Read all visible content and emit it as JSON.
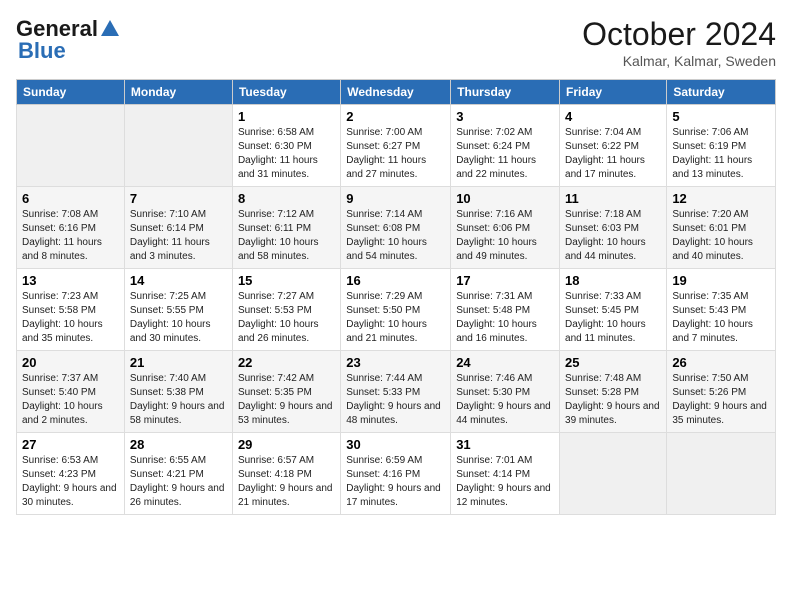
{
  "logo": {
    "general": "General",
    "blue": "Blue"
  },
  "header": {
    "month": "October 2024",
    "location": "Kalmar, Kalmar, Sweden"
  },
  "days_of_week": [
    "Sunday",
    "Monday",
    "Tuesday",
    "Wednesday",
    "Thursday",
    "Friday",
    "Saturday"
  ],
  "weeks": [
    [
      {
        "day": "",
        "empty": true
      },
      {
        "day": "",
        "empty": true
      },
      {
        "day": "1",
        "sunrise": "6:58 AM",
        "sunset": "6:30 PM",
        "daylight": "11 hours and 31 minutes."
      },
      {
        "day": "2",
        "sunrise": "7:00 AM",
        "sunset": "6:27 PM",
        "daylight": "11 hours and 27 minutes."
      },
      {
        "day": "3",
        "sunrise": "7:02 AM",
        "sunset": "6:24 PM",
        "daylight": "11 hours and 22 minutes."
      },
      {
        "day": "4",
        "sunrise": "7:04 AM",
        "sunset": "6:22 PM",
        "daylight": "11 hours and 17 minutes."
      },
      {
        "day": "5",
        "sunrise": "7:06 AM",
        "sunset": "6:19 PM",
        "daylight": "11 hours and 13 minutes."
      }
    ],
    [
      {
        "day": "6",
        "sunrise": "7:08 AM",
        "sunset": "6:16 PM",
        "daylight": "11 hours and 8 minutes."
      },
      {
        "day": "7",
        "sunrise": "7:10 AM",
        "sunset": "6:14 PM",
        "daylight": "11 hours and 3 minutes."
      },
      {
        "day": "8",
        "sunrise": "7:12 AM",
        "sunset": "6:11 PM",
        "daylight": "10 hours and 58 minutes."
      },
      {
        "day": "9",
        "sunrise": "7:14 AM",
        "sunset": "6:08 PM",
        "daylight": "10 hours and 54 minutes."
      },
      {
        "day": "10",
        "sunrise": "7:16 AM",
        "sunset": "6:06 PM",
        "daylight": "10 hours and 49 minutes."
      },
      {
        "day": "11",
        "sunrise": "7:18 AM",
        "sunset": "6:03 PM",
        "daylight": "10 hours and 44 minutes."
      },
      {
        "day": "12",
        "sunrise": "7:20 AM",
        "sunset": "6:01 PM",
        "daylight": "10 hours and 40 minutes."
      }
    ],
    [
      {
        "day": "13",
        "sunrise": "7:23 AM",
        "sunset": "5:58 PM",
        "daylight": "10 hours and 35 minutes."
      },
      {
        "day": "14",
        "sunrise": "7:25 AM",
        "sunset": "5:55 PM",
        "daylight": "10 hours and 30 minutes."
      },
      {
        "day": "15",
        "sunrise": "7:27 AM",
        "sunset": "5:53 PM",
        "daylight": "10 hours and 26 minutes."
      },
      {
        "day": "16",
        "sunrise": "7:29 AM",
        "sunset": "5:50 PM",
        "daylight": "10 hours and 21 minutes."
      },
      {
        "day": "17",
        "sunrise": "7:31 AM",
        "sunset": "5:48 PM",
        "daylight": "10 hours and 16 minutes."
      },
      {
        "day": "18",
        "sunrise": "7:33 AM",
        "sunset": "5:45 PM",
        "daylight": "10 hours and 11 minutes."
      },
      {
        "day": "19",
        "sunrise": "7:35 AM",
        "sunset": "5:43 PM",
        "daylight": "10 hours and 7 minutes."
      }
    ],
    [
      {
        "day": "20",
        "sunrise": "7:37 AM",
        "sunset": "5:40 PM",
        "daylight": "10 hours and 2 minutes."
      },
      {
        "day": "21",
        "sunrise": "7:40 AM",
        "sunset": "5:38 PM",
        "daylight": "9 hours and 58 minutes."
      },
      {
        "day": "22",
        "sunrise": "7:42 AM",
        "sunset": "5:35 PM",
        "daylight": "9 hours and 53 minutes."
      },
      {
        "day": "23",
        "sunrise": "7:44 AM",
        "sunset": "5:33 PM",
        "daylight": "9 hours and 48 minutes."
      },
      {
        "day": "24",
        "sunrise": "7:46 AM",
        "sunset": "5:30 PM",
        "daylight": "9 hours and 44 minutes."
      },
      {
        "day": "25",
        "sunrise": "7:48 AM",
        "sunset": "5:28 PM",
        "daylight": "9 hours and 39 minutes."
      },
      {
        "day": "26",
        "sunrise": "7:50 AM",
        "sunset": "5:26 PM",
        "daylight": "9 hours and 35 minutes."
      }
    ],
    [
      {
        "day": "27",
        "sunrise": "6:53 AM",
        "sunset": "4:23 PM",
        "daylight": "9 hours and 30 minutes."
      },
      {
        "day": "28",
        "sunrise": "6:55 AM",
        "sunset": "4:21 PM",
        "daylight": "9 hours and 26 minutes."
      },
      {
        "day": "29",
        "sunrise": "6:57 AM",
        "sunset": "4:18 PM",
        "daylight": "9 hours and 21 minutes."
      },
      {
        "day": "30",
        "sunrise": "6:59 AM",
        "sunset": "4:16 PM",
        "daylight": "9 hours and 17 minutes."
      },
      {
        "day": "31",
        "sunrise": "7:01 AM",
        "sunset": "4:14 PM",
        "daylight": "9 hours and 12 minutes."
      },
      {
        "day": "",
        "empty": true
      },
      {
        "day": "",
        "empty": true
      }
    ]
  ],
  "labels": {
    "sunrise": "Sunrise:",
    "sunset": "Sunset:",
    "daylight": "Daylight:"
  }
}
